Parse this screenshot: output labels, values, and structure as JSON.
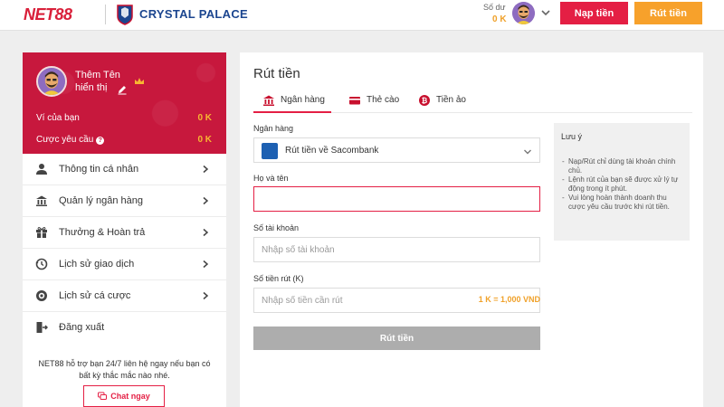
{
  "header": {
    "logo_text": "NET88",
    "partner_text": "CRYSTAL PALACE",
    "balance_label": "Số dư",
    "balance_value": "0 K",
    "deposit_label": "Nạp tiền",
    "withdraw_label": "Rút tiền"
  },
  "sidebar": {
    "profile": {
      "name": "Thêm Tên hiển thị",
      "wallet_label": "Ví của bạn",
      "wallet_value": "0 K",
      "wager_label": "Cược yêu cầu",
      "wager_value": "0 K"
    },
    "items": [
      {
        "label": "Thông tin cá nhân",
        "icon": "user-icon"
      },
      {
        "label": "Quản lý ngân hàng",
        "icon": "bank-icon"
      },
      {
        "label": "Thưởng & Hoàn trả",
        "icon": "gift-icon"
      },
      {
        "label": "Lịch sử giao dịch",
        "icon": "history-icon"
      },
      {
        "label": "Lịch sử cá cược",
        "icon": "chip-icon"
      },
      {
        "label": "Đăng xuất",
        "icon": "logout-icon"
      }
    ],
    "support_text": "NET88 hỗ trợ bạn 24/7 liên hệ ngay nếu bạn có bất kỳ thắc mắc nào nhé.",
    "chat_label": "Chat ngay"
  },
  "main": {
    "title": "Rút tiền",
    "tabs": [
      {
        "label": "Ngân hàng",
        "active": true
      },
      {
        "label": "Thẻ cào",
        "active": false
      },
      {
        "label": "Tiền ảo",
        "active": false
      }
    ],
    "bank_label": "Ngân hàng",
    "bank_value": "Rút tiền về Sacombank",
    "name_label": "Họ và tên",
    "name_value": "",
    "account_label": "Số tài khoản",
    "account_placeholder": "Nhập số tài khoản",
    "amount_label": "Số tiền rút (K)",
    "amount_placeholder": "Nhập số tiền cần rút",
    "rate_hint": "1 K = 1,000 VND",
    "submit_label": "Rút tiền"
  },
  "note": {
    "title": "Lưu ý",
    "items": [
      "Nạp/Rút chỉ dùng tài khoản chính chủ.",
      "Lệnh rút của bạn sẽ được xử lý tự động trong ít phút.",
      "Vui lòng hoàn thành doanh thu cược yêu cầu trước khi rút tiền."
    ]
  },
  "colors": {
    "brand_red": "#e41f44",
    "accent_orange": "#f7a12b",
    "profile_bg": "#c7183d",
    "disabled_gray": "#adadad"
  }
}
